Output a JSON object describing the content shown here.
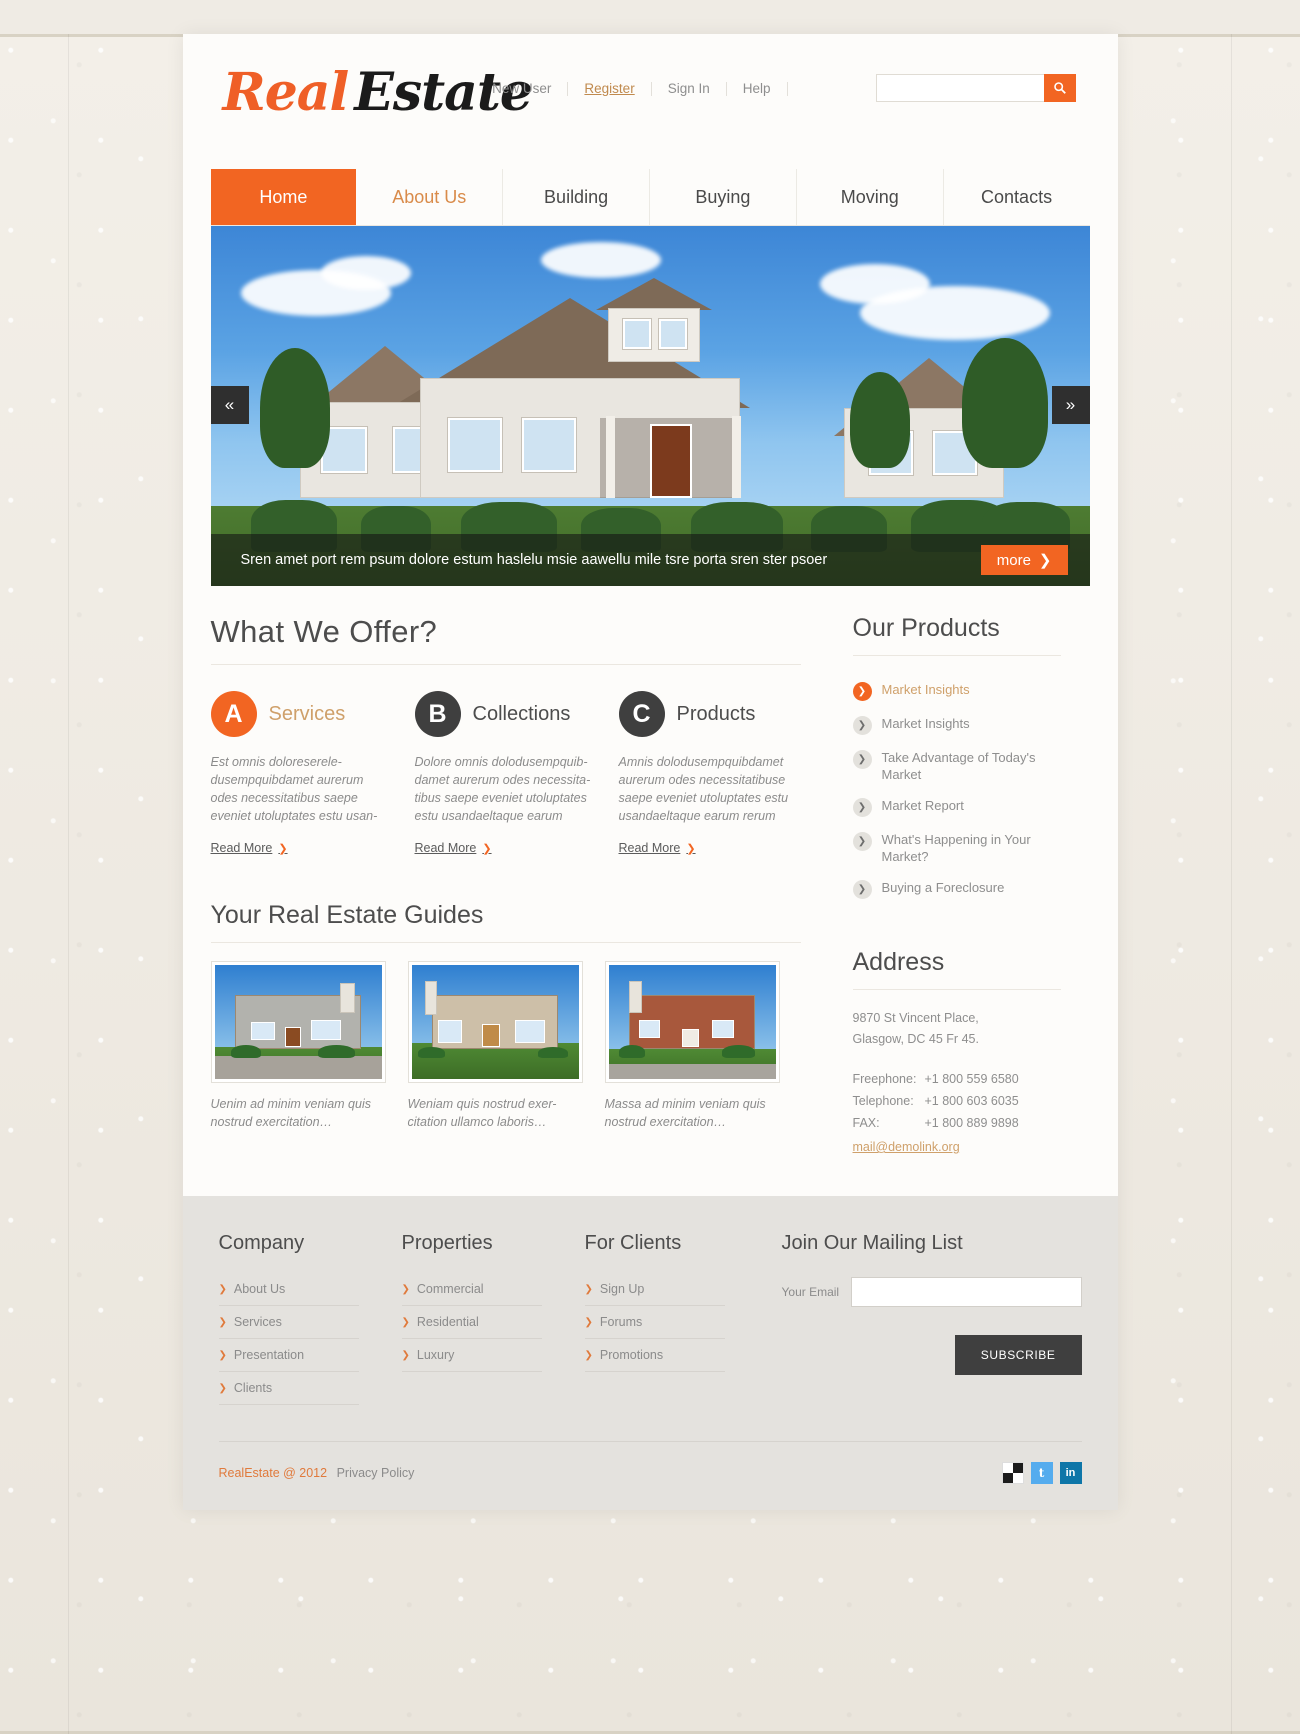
{
  "header": {
    "logo": {
      "first": "Real",
      "second": "Estate"
    },
    "top_links": [
      {
        "label": "New User",
        "active": false
      },
      {
        "label": "Register",
        "active": true
      },
      {
        "label": "Sign In",
        "active": false
      },
      {
        "label": "Help",
        "active": false
      }
    ],
    "search": {
      "value": "",
      "placeholder": "",
      "icon": "search-icon"
    }
  },
  "nav": [
    {
      "label": "Home",
      "state": "active"
    },
    {
      "label": "About Us",
      "state": "accent"
    },
    {
      "label": "Building",
      "state": "normal"
    },
    {
      "label": "Buying",
      "state": "normal"
    },
    {
      "label": "Moving",
      "state": "normal"
    },
    {
      "label": "Contacts",
      "state": "normal"
    }
  ],
  "slider": {
    "caption": "Sren amet port rem psum dolore estum haslelu msie aawellu mile tsre porta sren ster psoer",
    "more_label": "more",
    "prev_icon": "«",
    "next_icon": "»",
    "more_chevron": "❯"
  },
  "offers": {
    "heading": "What We Offer?",
    "items": [
      {
        "badge": "A",
        "title": "Services",
        "text": "Est omnis doloreserele-dusempquibdamet aurerum odes necessitatibus saepe eveniet utoluptates estu usan-",
        "read_more": "Read More",
        "accent": true
      },
      {
        "badge": "B",
        "title": "Collections",
        "text": "Dolore omnis dolodusempquib-damet aurerum odes necessita-tibus saepe eveniet utoluptates estu usandaeltaque earum",
        "read_more": "Read More",
        "accent": false
      },
      {
        "badge": "C",
        "title": "Products",
        "text": "Amnis dolodusempquibdamet aurerum odes necessitatibuse saepe eveniet utoluptates estu usandaeltaque earum rerum",
        "read_more": "Read More",
        "accent": false
      }
    ]
  },
  "guides": {
    "heading": "Your Real Estate Guides",
    "items": [
      {
        "text": "Uenim ad minim veniam quis nostrud exercitation…"
      },
      {
        "text": "Weniam quis nostrud exer-citation ullamco laboris…"
      },
      {
        "text": "Massa ad minim veniam quis nostrud exercitation…"
      }
    ]
  },
  "products": {
    "heading": "Our Products",
    "items": [
      {
        "label": "Market Insights",
        "active": true
      },
      {
        "label": "Market Insights",
        "active": false
      },
      {
        "label": "Take Advantage of Today's Market",
        "active": false
      },
      {
        "label": "Market Report",
        "active": false
      },
      {
        "label": "What's Happening in Your Market?",
        "active": false
      },
      {
        "label": "Buying a Foreclosure",
        "active": false
      }
    ]
  },
  "address": {
    "heading": "Address",
    "street": "9870 St Vincent Place,",
    "city": "Glasgow, DC 45 Fr 45.",
    "contacts": [
      {
        "label": "Freephone:",
        "value": "+1 800 559 6580"
      },
      {
        "label": "Telephone:",
        "value": "+1 800 603 6035"
      },
      {
        "label": "FAX:",
        "value": "+1 800 889 9898"
      }
    ],
    "email": "mail@demolink.org"
  },
  "footer": {
    "columns": [
      {
        "title": "Company",
        "links": [
          "About Us",
          "Services",
          "Presentation",
          "Clients"
        ]
      },
      {
        "title": "Properties",
        "links": [
          "Commercial",
          "Residential",
          "Luxury"
        ]
      },
      {
        "title": "For Clients",
        "links": [
          "Sign Up",
          "Forums",
          "Promotions"
        ]
      }
    ],
    "mailing": {
      "title": "Join Our Mailing List",
      "field_label": "Your Email",
      "field_value": "",
      "button": "SUBSCRIBE"
    },
    "copyright": "RealEstate @ 2012",
    "privacy": "Privacy Policy",
    "socials": [
      {
        "name": "delicious-icon",
        "glyph": ""
      },
      {
        "name": "twitter-icon",
        "glyph": "t"
      },
      {
        "name": "linkedin-icon",
        "glyph": "in"
      }
    ]
  },
  "colors": {
    "accent": "#f26522",
    "gold": "#cfa06a",
    "dark": "#3f3f3f"
  }
}
